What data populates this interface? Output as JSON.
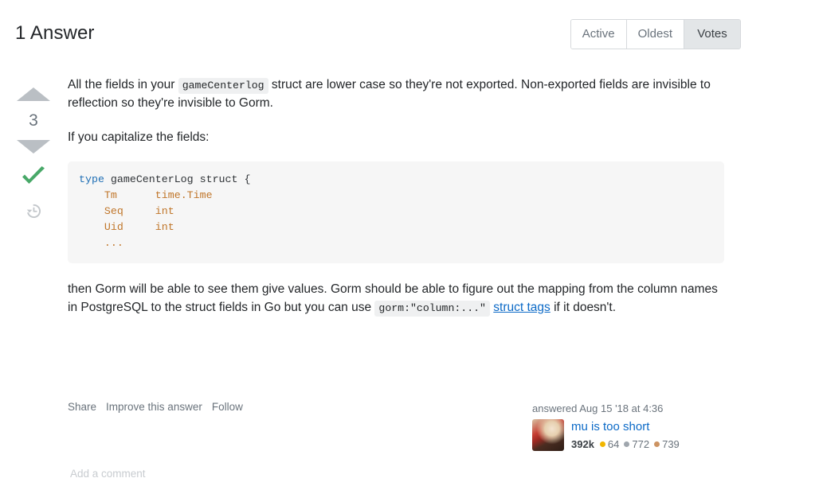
{
  "header": {
    "answers_title": "1 Answer",
    "sort_tabs": [
      {
        "label": "Active",
        "selected": false
      },
      {
        "label": "Oldest",
        "selected": false
      },
      {
        "label": "Votes",
        "selected": true
      }
    ]
  },
  "answer": {
    "vote_count": "3",
    "upvote_icon": "triangle-up-icon",
    "downvote_icon": "triangle-down-icon",
    "accepted_icon": "checkmark-icon",
    "history_icon": "clock-history-icon",
    "paragraph_1": {
      "before_code": "All the fields in your ",
      "code": "gameCenterlog",
      "after_code": " struct are lower case so they're not exported. Non-exported fields are invisible to reflection so they're invisible to Gorm."
    },
    "paragraph_2": "If you capitalize the fields:",
    "code_block": {
      "line_1": {
        "kw": "type",
        "rest": " gameCenterLog struct {"
      },
      "line_2": {
        "name": "Tm",
        "type": "time.Time"
      },
      "line_3": {
        "name": "Seq",
        "type": "int"
      },
      "line_4": {
        "name": "Uid",
        "type": "int"
      },
      "line_5": "..."
    },
    "paragraph_3": {
      "text_before": "then Gorm will be able to see them give values. Gorm should be able to figure out the mapping from the column names in PostgreSQL to the struct fields in Go but you can use ",
      "code": "gorm:\"column:...\"",
      "link": "struct tags",
      "text_after": " if it doesn't."
    },
    "actions": [
      "Share",
      "Improve this answer",
      "Follow"
    ],
    "user_card": {
      "answered_line": "answered Aug 15 '18 at 4:36",
      "username": "mu is too short",
      "reputation": "392k",
      "badges": [
        {
          "kind": "gold",
          "count": "64"
        },
        {
          "kind": "silver",
          "count": "772"
        },
        {
          "kind": "bronze",
          "count": "739"
        }
      ]
    },
    "add_comment": "Add a comment"
  },
  "colors": {
    "link": "#0c6ac7",
    "accepted_green": "#48a868",
    "vote_arrow": "#babfc4",
    "code_bg": "#f6f6f6",
    "keyword_blue": "#1f6fb5",
    "identifier_orange": "#c0762a",
    "gold": "#f1b600",
    "silver": "#9fa6ad",
    "bronze": "#cc9362"
  }
}
